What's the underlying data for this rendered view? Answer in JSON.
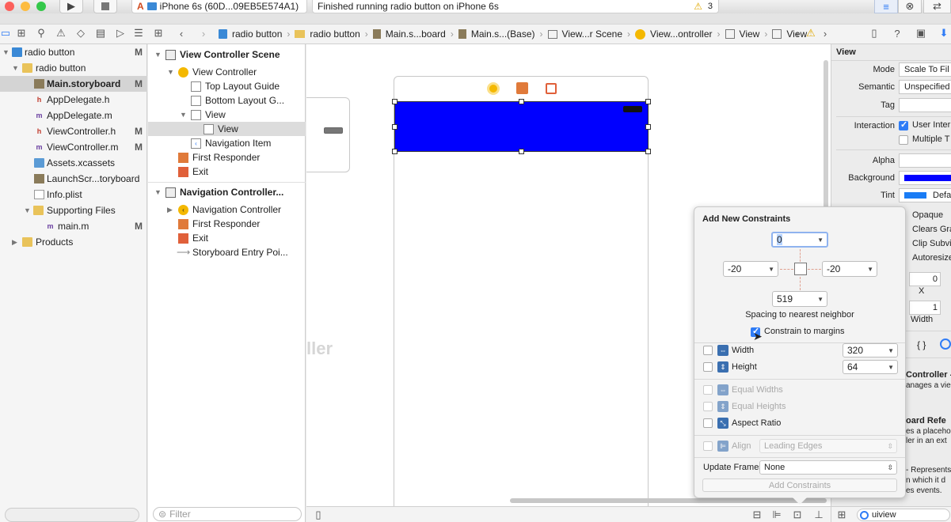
{
  "colors": {
    "selection_blue": "#0000ff",
    "accent": "#2f7cf6",
    "warning": "#f0b800"
  },
  "toolbar": {
    "scheme_label": "A",
    "device_label": "iPhone 6s (60D...09EB5E574A1)",
    "status_text": "Finished running radio button on iPhone 6s",
    "warning_count": "3"
  },
  "breadcrumbs": [
    "radio button",
    "radio button",
    "Main.s...board",
    "Main.s...(Base)",
    "View...r Scene",
    "View...ontroller",
    "View",
    "View"
  ],
  "navigator": {
    "items": [
      {
        "label": "radio button",
        "flag": "M"
      },
      {
        "label": "radio button",
        "flag": ""
      },
      {
        "label": "Main.storyboard",
        "flag": "M"
      },
      {
        "label": "AppDelegate.h",
        "flag": ""
      },
      {
        "label": "AppDelegate.m",
        "flag": ""
      },
      {
        "label": "ViewController.h",
        "flag": "M"
      },
      {
        "label": "ViewController.m",
        "flag": "M"
      },
      {
        "label": "Assets.xcassets",
        "flag": ""
      },
      {
        "label": "LaunchScr...toryboard",
        "flag": ""
      },
      {
        "label": "Info.plist",
        "flag": ""
      },
      {
        "label": "Supporting Files",
        "flag": ""
      },
      {
        "label": "main.m",
        "flag": "M"
      },
      {
        "label": "Products",
        "flag": ""
      }
    ]
  },
  "outline": {
    "items": [
      {
        "label": "View Controller Scene"
      },
      {
        "label": "View Controller"
      },
      {
        "label": "Top Layout Guide"
      },
      {
        "label": "Bottom Layout G..."
      },
      {
        "label": "View"
      },
      {
        "label": "View"
      },
      {
        "label": "Navigation Item"
      },
      {
        "label": "First Responder"
      },
      {
        "label": "Exit"
      },
      {
        "label": "Navigation Controller..."
      },
      {
        "label": "Navigation Controller"
      },
      {
        "label": "First Responder"
      },
      {
        "label": "Exit"
      },
      {
        "label": "Storyboard Entry Poi..."
      }
    ],
    "filter_placeholder": "Filter"
  },
  "canvas": {
    "ghost_text": "ller",
    "bottom_label": "uiview"
  },
  "inspector": {
    "title": "View",
    "mode_label": "Mode",
    "mode_value": "Scale To Fil",
    "semantic_label": "Semantic",
    "semantic_value": "Unspecified",
    "tag_label": "Tag",
    "interaction_label": "Interaction",
    "user_interaction": "User Inter",
    "multiple_touch": "Multiple T",
    "alpha_label": "Alpha",
    "background_label": "Background",
    "tint_label": "Tint",
    "tint_value": "Defa",
    "opaque": "Opaque",
    "clears": "Clears Gra",
    "clip": "Clip Subvi",
    "autoresize": "Autoresize",
    "stretch_x": "0",
    "x_label": "X",
    "stretch_w": "1",
    "width_label": "Width",
    "obj_title": "Controller -",
    "obj_desc": "anages a vie",
    "ref_title": "oard Refe",
    "ref_desc1": "es a placeho",
    "ref_desc2": "ler in an ext",
    "ref3": "- Represents",
    "ref4": "n which it d",
    "ref5": "es events.",
    "braces": "{ }"
  },
  "popover": {
    "title": "Add New Constraints",
    "top": "0",
    "left": "-20",
    "right": "-20",
    "bottom": "519",
    "spacing_label": "Spacing to nearest neighbor",
    "constrain_margins": "Constrain to margins",
    "width_label": "Width",
    "width_value": "320",
    "height_label": "Height",
    "height_value": "64",
    "equal_widths": "Equal Widths",
    "equal_heights": "Equal Heights",
    "aspect_ratio": "Aspect Ratio",
    "align_label": "Align",
    "align_value": "Leading Edges",
    "update_frames_label": "Update Frames",
    "update_frames_value": "None",
    "add_button": "Add Constraints"
  }
}
